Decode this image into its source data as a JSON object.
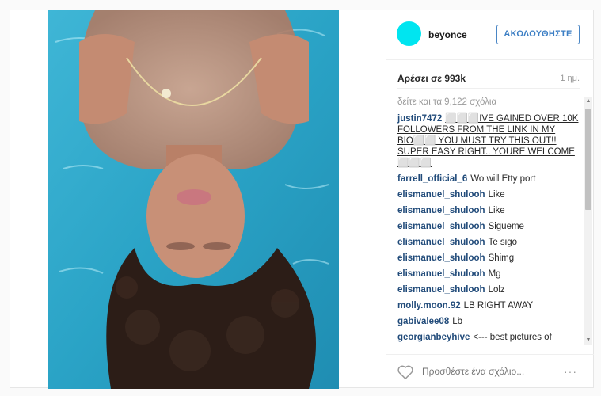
{
  "post": {
    "username": "beyonce",
    "follow_label": "ΑΚΟΛΟΥΘΗΣΤΕ",
    "likes": "Αρέσει σε 993k",
    "time": "1 ημ.",
    "view_all": "δείτε και τα 9,122 σχόλια",
    "comment_placeholder": "Προσθέστε ένα σχόλιο...",
    "more_label": "···",
    "colors": {
      "avatar": "#00e5f0",
      "follow": "#3b7ec4",
      "username_link": "#214b7a"
    }
  },
  "comments": [
    {
      "user": "justin7472",
      "text": "⬜⬜⬜IVE GAINED OVER 10K FOLLOWERS FROM THE LINK IN MY BIO⬜⬜ YOU MUST TRY THIS OUT!! SUPER EASY RIGHT.. YOURE WELCOME ⬜⬜⬜"
    },
    {
      "user": "farrell_official_6",
      "text": "Wo will Etty port"
    },
    {
      "user": "elismanuel_shulooh",
      "text": "Like"
    },
    {
      "user": "elismanuel_shulooh",
      "text": "Like"
    },
    {
      "user": "elismanuel_shulooh",
      "text": "Sigueme"
    },
    {
      "user": "elismanuel_shulooh",
      "text": "Te sigo"
    },
    {
      "user": "elismanuel_shulooh",
      "text": "Shimg"
    },
    {
      "user": "elismanuel_shulooh",
      "text": "Mg"
    },
    {
      "user": "elismanuel_shulooh",
      "text": "Lolz"
    },
    {
      "user": "molly.moon.92",
      "text": "LB RIGHT AWAY"
    },
    {
      "user": "gabivalee08",
      "text": "Lb"
    },
    {
      "user": "georgianbeyhive",
      "text": "<--- best pictures of"
    }
  ]
}
